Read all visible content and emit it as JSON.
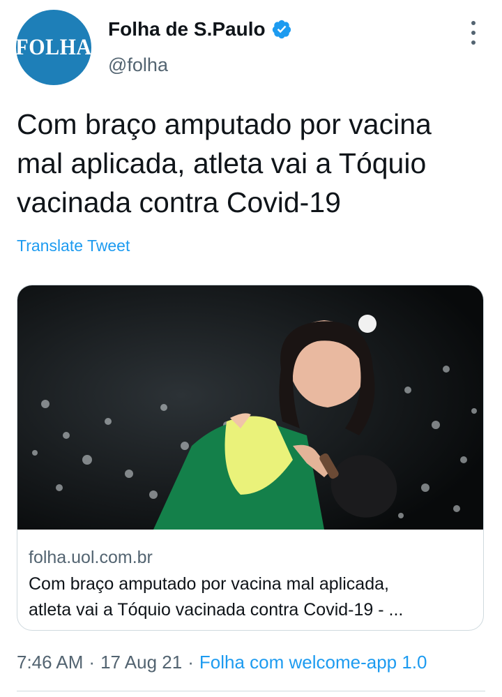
{
  "author": {
    "avatar_text": "FOLHA",
    "display_name": "Folha de S.Paulo",
    "handle": "@folha"
  },
  "tweet": {
    "text": "Com braço amputado por vacina mal aplicada, atleta vai a Tóquio vacinada contra Covid-19",
    "translate_label": "Translate Tweet"
  },
  "card": {
    "domain": "folha.uol.com.br",
    "title": "Com braço amputado por vacina mal aplicada,\natleta vai a Tóquio vacinada contra Covid-19 - ..."
  },
  "meta": {
    "time": "7:46 AM",
    "date": "17 Aug 21",
    "separator": "·",
    "source": "Folha com welcome-app 1.0"
  },
  "colors": {
    "accent": "#1d9bf0",
    "avatar_bg": "#1e7fb8",
    "secondary_text": "#536471",
    "jersey_green": "#14804a",
    "jersey_yellow": "#eaf27a"
  },
  "icons": {
    "verified": "verified-badge-icon",
    "more": "more-options-icon"
  }
}
